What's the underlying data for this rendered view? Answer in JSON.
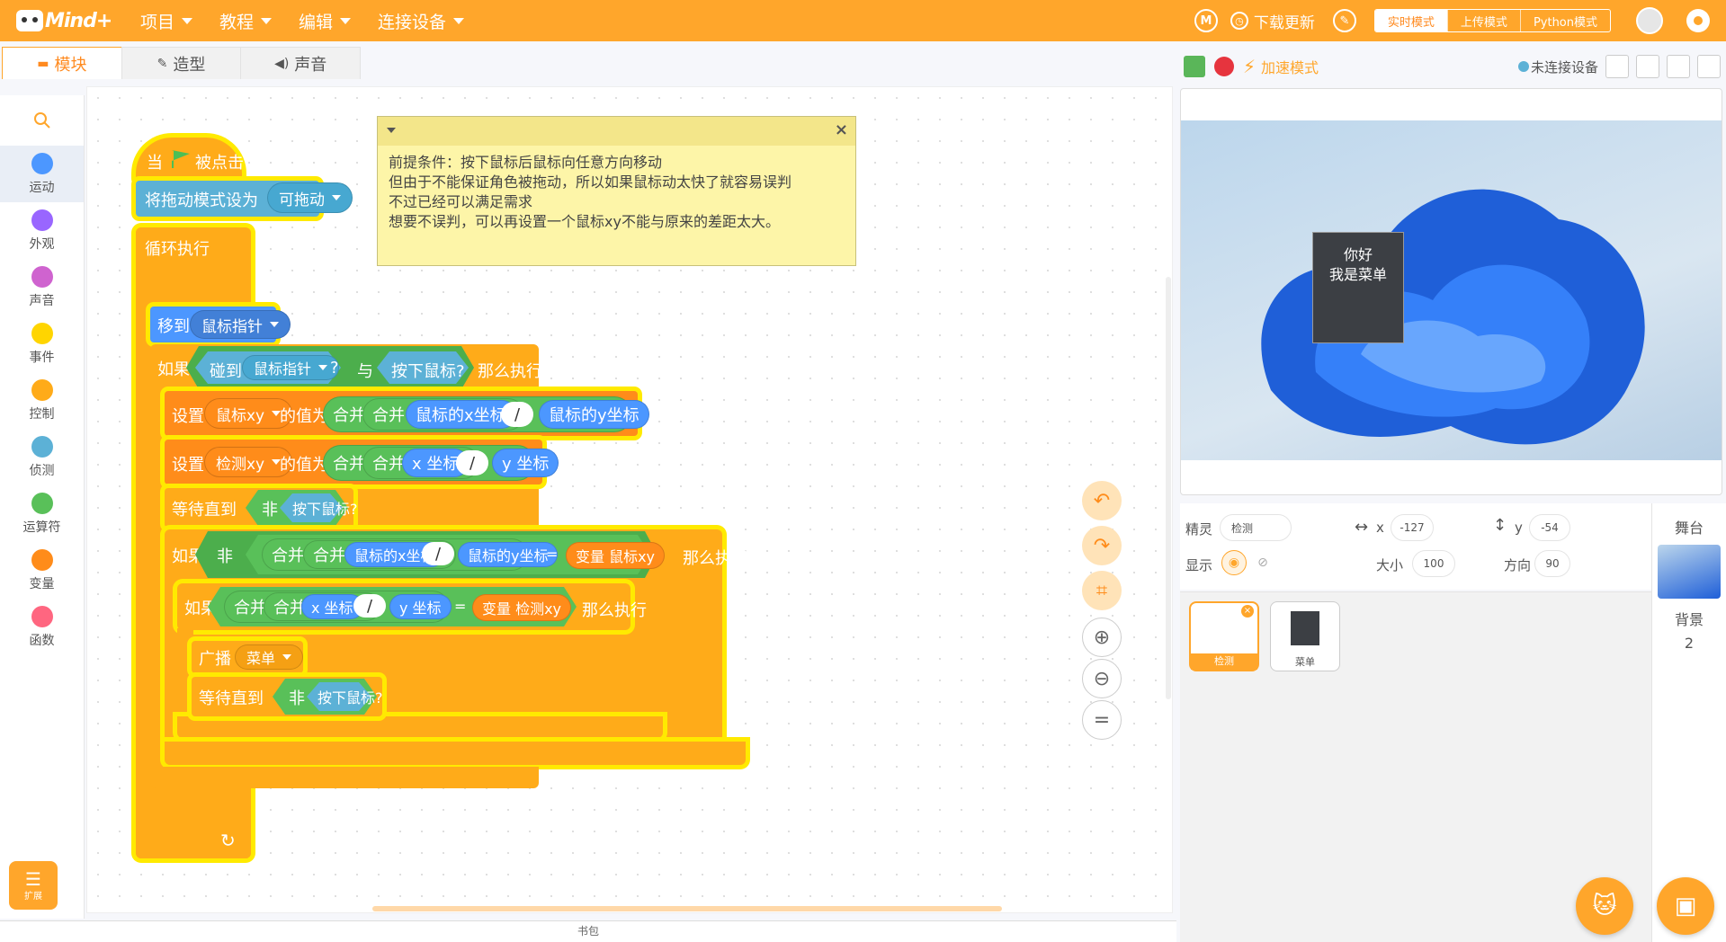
{
  "app": {
    "logo": "Mind+"
  },
  "menu": [
    {
      "label": "项目"
    },
    {
      "label": "教程"
    },
    {
      "label": "编辑"
    },
    {
      "label": "连接设备"
    }
  ],
  "topright": {
    "download_update": "下载更新",
    "modes": [
      "实时模式",
      "上传模式",
      "Python模式"
    ]
  },
  "tabs": [
    {
      "label": "模块",
      "icon": "blocks-icon"
    },
    {
      "label": "造型",
      "icon": "brush-icon"
    },
    {
      "label": "声音",
      "icon": "speaker-icon"
    }
  ],
  "categories": [
    {
      "label": "运动",
      "color": "#4c97ff"
    },
    {
      "label": "外观",
      "color": "#9966ff"
    },
    {
      "label": "声音",
      "color": "#cf63cf"
    },
    {
      "label": "事件",
      "color": "#ffd500"
    },
    {
      "label": "控制",
      "color": "#ffab19"
    },
    {
      "label": "侦测",
      "color": "#5cb1d6"
    },
    {
      "label": "运算符",
      "color": "#59c059"
    },
    {
      "label": "变量",
      "color": "#ff8c1a"
    },
    {
      "label": "函数",
      "color": "#ff6680"
    }
  ],
  "extension_label": "扩展",
  "code": {
    "hat": {
      "when": "当",
      "clicked": "被点击"
    },
    "drag": {
      "label": "将拖动模式设为",
      "value": "可拖动"
    },
    "forever": "循环执行",
    "goto": {
      "label": "移到",
      "value": "鼠标指针"
    },
    "if1": {
      "if": "如果",
      "touch": "碰到",
      "touch_value": "鼠标指针",
      "q": "?",
      "and": "与",
      "mouse_down": "按下鼠标?",
      "then": "那么执行"
    },
    "set1": {
      "set": "设置",
      "var": "鼠标xy",
      "to": "的值为",
      "join": "合并",
      "a": "鼠标的x坐标",
      "slash": "/",
      "b": "鼠标的y坐标"
    },
    "set2": {
      "set": "设置",
      "var": "检测xy",
      "to": "的值为",
      "join": "合并",
      "a": "x 坐标",
      "slash": "/",
      "b": "y 坐标"
    },
    "wait1": {
      "label": "等待直到",
      "not": "非",
      "cond": "按下鼠标?"
    },
    "if2": {
      "if": "如果",
      "not": "非",
      "join": "合并",
      "a": "鼠标的x坐标",
      "slash": "/",
      "b": "鼠标的y坐标",
      "eq": "=",
      "var": "变量 鼠标xy",
      "then": "那么执行"
    },
    "if3": {
      "if": "如果",
      "join": "合并",
      "a": "x 坐标",
      "slash": "/",
      "b": "y 坐标",
      "eq": "=",
      "var": "变量 检测xy",
      "then": "那么执行"
    },
    "broadcast": {
      "label": "广播",
      "value": "菜单"
    },
    "wait2": {
      "label": "等待直到",
      "not": "非",
      "cond": "按下鼠标?"
    },
    "loop_arrow": "↻"
  },
  "comment": {
    "lines": [
      "前提条件：按下鼠标后鼠标向任意方向移动",
      "但由于不能保证角色被拖动，所以如果鼠标动太快了就容易误判",
      "不过已经可以满足需求",
      "想要不误判，可以再设置一个鼠标xy不能与原来的差距太大。"
    ]
  },
  "bag_label": "书包",
  "stagebar": {
    "turbo": "加速模式",
    "device": "未连接设备"
  },
  "stage": {
    "sprite_text_1": "你好",
    "sprite_text_2": "我是菜单"
  },
  "sprite_info": {
    "sprite_label": "精灵",
    "sprite_name": "检测",
    "x_label": "x",
    "x": "-127",
    "y_label": "y",
    "y": "-54",
    "show_label": "显示",
    "size_label": "大小",
    "size": "100",
    "dir_label": "方向",
    "dir": "90"
  },
  "sprites": [
    {
      "name": "检测",
      "selected": true
    },
    {
      "name": "菜单",
      "selected": false
    }
  ],
  "stage_panel": {
    "title": "舞台",
    "backdrop_label": "背景",
    "backdrop_count": "2"
  }
}
